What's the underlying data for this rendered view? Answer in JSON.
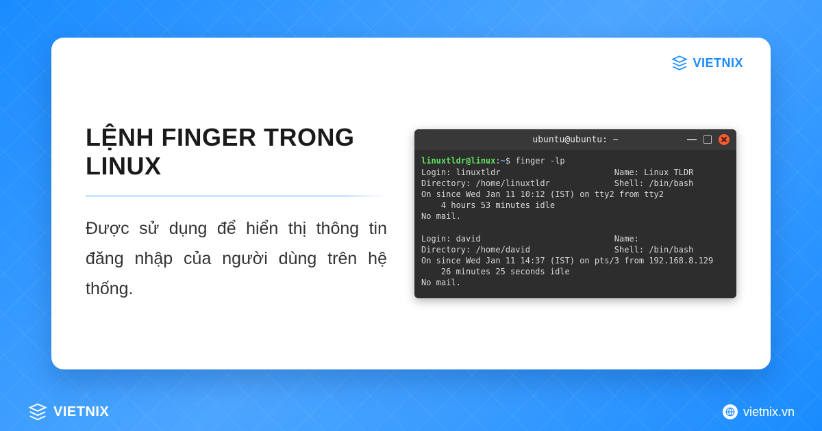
{
  "brand": "VIETNIX",
  "title": "LỆNH FINGER TRONG LINUX",
  "description": "Được sử dụng để hiển thị thông tin đăng nhập của người dùng trên hệ thống.",
  "terminal": {
    "window_title": "ubuntu@ubuntu: ~",
    "prompt_user": "linuxtldr@linux",
    "prompt_path": "~",
    "prompt_sep": ":",
    "prompt_symbol": "$",
    "command": "finger -lp",
    "block1_login": "Login: linuxtldr                       Name: Linux TLDR",
    "block1_dir": "Directory: /home/linuxtldr             Shell: /bin/bash",
    "block1_since": "On since Wed Jan 11 10:12 (IST) on tty2 from tty2",
    "block1_idle": "    4 hours 53 minutes idle",
    "block1_mail": "No mail.",
    "block2_login": "Login: david                           Name:",
    "block2_dir": "Directory: /home/david                 Shell: /bin/bash",
    "block2_since": "On since Wed Jan 11 14:37 (IST) on pts/3 from 192.168.8.129",
    "block2_idle": "    26 minutes 25 seconds idle",
    "block2_mail": "No mail."
  },
  "footer_site": "vietnix.vn"
}
